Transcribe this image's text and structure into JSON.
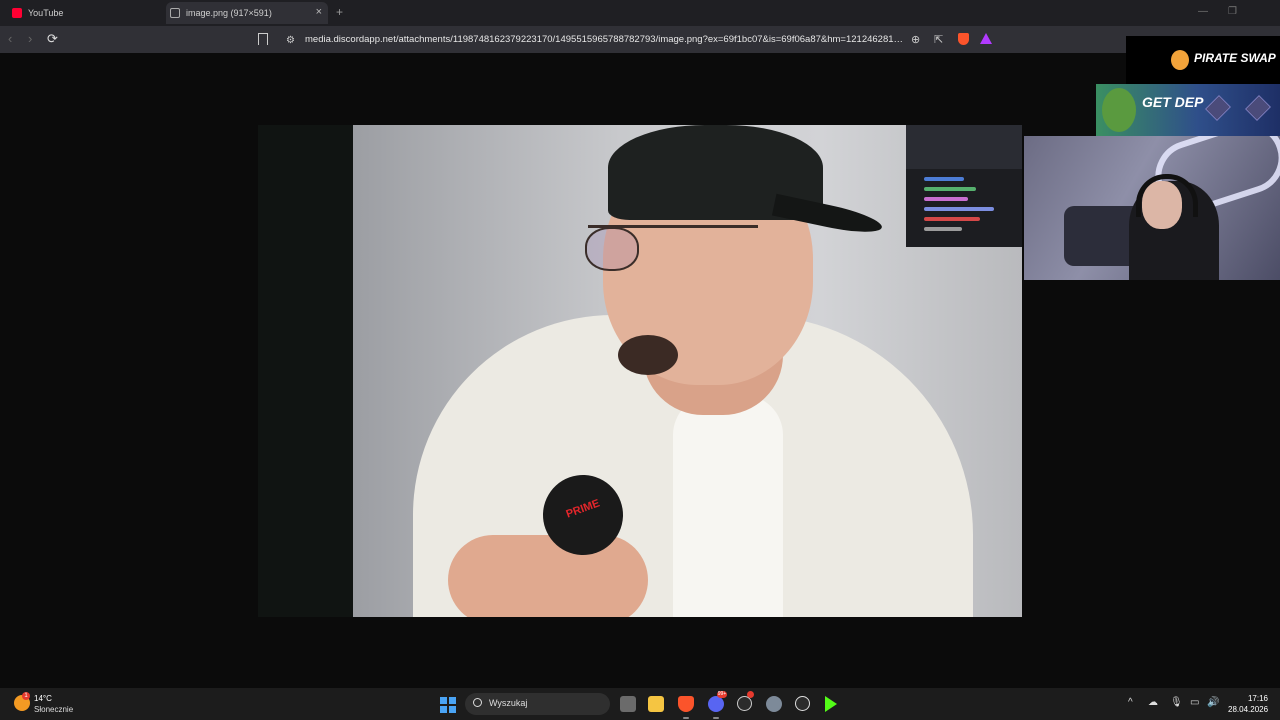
{
  "browser": {
    "tabs": [
      {
        "title": "YouTube",
        "icon": "youtube-icon"
      },
      {
        "title": "image.png (917×591)",
        "icon": "globe-icon",
        "active": true
      }
    ],
    "close_glyph": "×",
    "new_tab_glyph": "+",
    "url": "media.discordapp.net/attachments/1198748162379223170/1495515965788782793/image.png?ex=69f1bc07&is=69f06a87&hm=1212462813c..."
  },
  "image": {
    "mic_brand": "PRIME"
  },
  "overlays": {
    "sponsor_logo": "PIRATE SWAP",
    "sponsor_banner": "GET DEP"
  },
  "taskbar": {
    "weather": {
      "temp": "14°C",
      "condition": "Słonecznie",
      "badge": "1"
    },
    "search_placeholder": "Wyszukaj",
    "discord_badge": "99+",
    "time": "17:16",
    "date": "28.04.2026"
  },
  "colors": {
    "taskbar_bg": "#1c1c1c",
    "tab_bar_bg": "#1f1f23",
    "toolbar_bg": "#303036",
    "brave_orange": "#fb542b"
  }
}
